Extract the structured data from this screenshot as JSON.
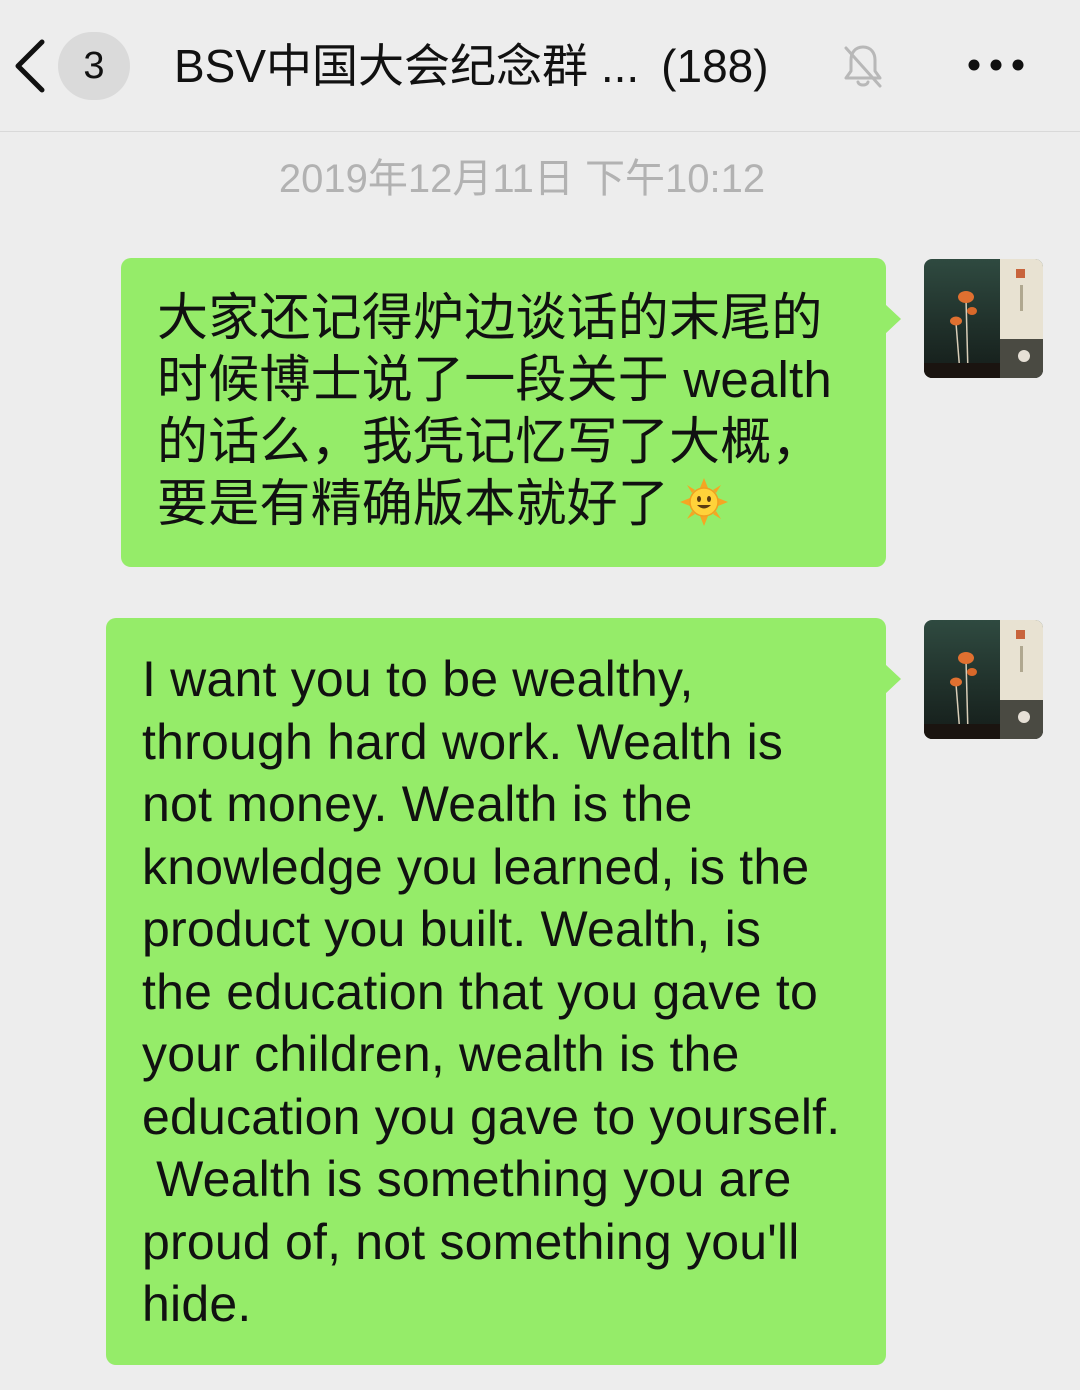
{
  "header": {
    "back_label": "back",
    "unread_count": "3",
    "title": "BSV中国大会纪念群 ...",
    "member_count": "(188)",
    "mute_icon": "bell-slash-icon",
    "more_icon": "ellipsis-icon"
  },
  "chat": {
    "timestamp": "2019年12月11日 下午10:12",
    "messages": [
      {
        "text": "大家还记得炉边谈话的末尾的\n时候博士说了一段关于 wealth\n的话么，我凭记忆写了大概，\n要是有精确版本就好了",
        "emoji": "sun-face-emoji",
        "avatar": "avatar-mushroom-photo"
      },
      {
        "text": "I want you to be wealthy,\nthrough hard work. Wealth is\nnot money. Wealth is the\nknowledge you learned, is the\nproduct you built. Wealth, is\nthe education that you gave to\nyour children, wealth is the\neducation you gave to yourself.\n Wealth is something you are\nproud of, not something you'll\nhide.",
        "avatar": "avatar-mushroom-photo"
      }
    ]
  },
  "colors": {
    "background": "#ededed",
    "bubble_outgoing": "#95ec69",
    "timestamp_text": "#b2b2b2",
    "text": "#111111"
  }
}
